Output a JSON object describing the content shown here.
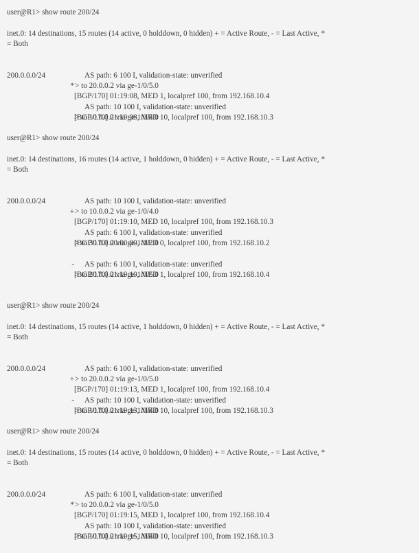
{
  "outputs": [
    {
      "prompt": "user@R1> show route 200/24",
      "summary_line1": "inet.0: 14 destinations, 15 routes (14 active, 0 holddown, 0 hidden) + = Active Route, - = Last Active, *",
      "summary_line2": "= Both",
      "prefix": "200.0.0.0/24",
      "routes": [
        {
          "flag": "*",
          "entry": "[BGP/170] 01:19:08, MED 1, localpref 100, from 192.168.10.4",
          "as_path": "AS path: 6 100 I, validation-state: unverified",
          "next_hop": "> to 20.0.0.2 via ge-1/0/5.0"
        },
        {
          "flag": "",
          "entry": "[BGP/170] 01:19:08, MED 10, localpref 100, from 192.168.10.3",
          "as_path": "AS path: 10 100 I, validation-state: unverified",
          "next_hop": "> to 10.0.0.2 via ge-1/0/4.0"
        }
      ]
    },
    {
      "prompt": "user@R1> show route 200/24",
      "summary_line1": "inet.0: 14 destinations, 16 routes (14 active, 1 holddown, 0 hidden) + = Active Route, - = Last Active, *",
      "summary_line2": "= Both",
      "prefix": "200.0.0.0/24",
      "routes": [
        {
          "flag": "+",
          "entry": "[BGP/170] 01:19:10, MED 10, localpref 100, from 192.168.10.3",
          "as_path": "AS path: 10 100 I, validation-state: unverified",
          "next_hop": "> to 10.0.0.2 via ge-1/0/4.0"
        },
        {
          "flag": "",
          "entry": "[BGP/170] 00:00:00, MED 0, localpref 100, from 192.168.10.2",
          "as_path": "AS path: 6 100 I, validation-state: unverified",
          "next_hop": "> to 30.0.0.2 via ge-1/1/2.0"
        },
        {
          "flag": "-",
          "entry": "[BGP/170] 01:19:10, MED 1, localpref 100, from 192.168.10.4",
          "as_path": "AS path: 6 100 I, validation-state: unverified",
          "next_hop": "> to 20.0.0.2 via ge-1/0/5.0"
        }
      ]
    },
    {
      "prompt": "user@R1> show route 200/24",
      "summary_line1": "inet.0: 14 destinations, 15 routes (14 active, 1 holddown, 0 hidden) + = Active Route, - = Last Active, *",
      "summary_line2": "= Both",
      "prefix": "200.0.0.0/24",
      "routes": [
        {
          "flag": "+",
          "entry": "[BGP/170] 01:19:13, MED 1, localpref 100, from 192.168.10.4",
          "as_path": "AS path: 6 100 I, validation-state: unverified",
          "next_hop": "> to 20.0.0.2 via ge-1/0/5.0"
        },
        {
          "flag": "-",
          "entry": "[BGP/170] 01:19:13, MED 10, localpref 100, from 192.168.10.3",
          "as_path": "AS path: 10 100 I, validation-state: unverified",
          "next_hop": "> to 10.0.0.2 via ge-1/0/4.0"
        }
      ]
    },
    {
      "prompt": "user@R1> show route 200/24",
      "summary_line1": "inet.0: 14 destinations, 15 routes (14 active, 0 holddown, 0 hidden) + = Active Route, - = Last Active, *",
      "summary_line2": "= Both",
      "prefix": "200.0.0.0/24",
      "routes": [
        {
          "flag": "*",
          "entry": "[BGP/170] 01:19:15, MED 1, localpref 100, from 192.168.10.4",
          "as_path": "AS path: 6 100 I, validation-state: unverified",
          "next_hop": "> to 20.0.0.2 via ge-1/0/5.0"
        },
        {
          "flag": "",
          "entry": "[BGP/170] 01:19:15, MED 10, localpref 100, from 192.168.10.3",
          "as_path": "AS path: 10 100 I, validation-state: unverified",
          "next_hop": "> to 10.0.0.2 via ge-1/0/4.0"
        }
      ]
    }
  ]
}
